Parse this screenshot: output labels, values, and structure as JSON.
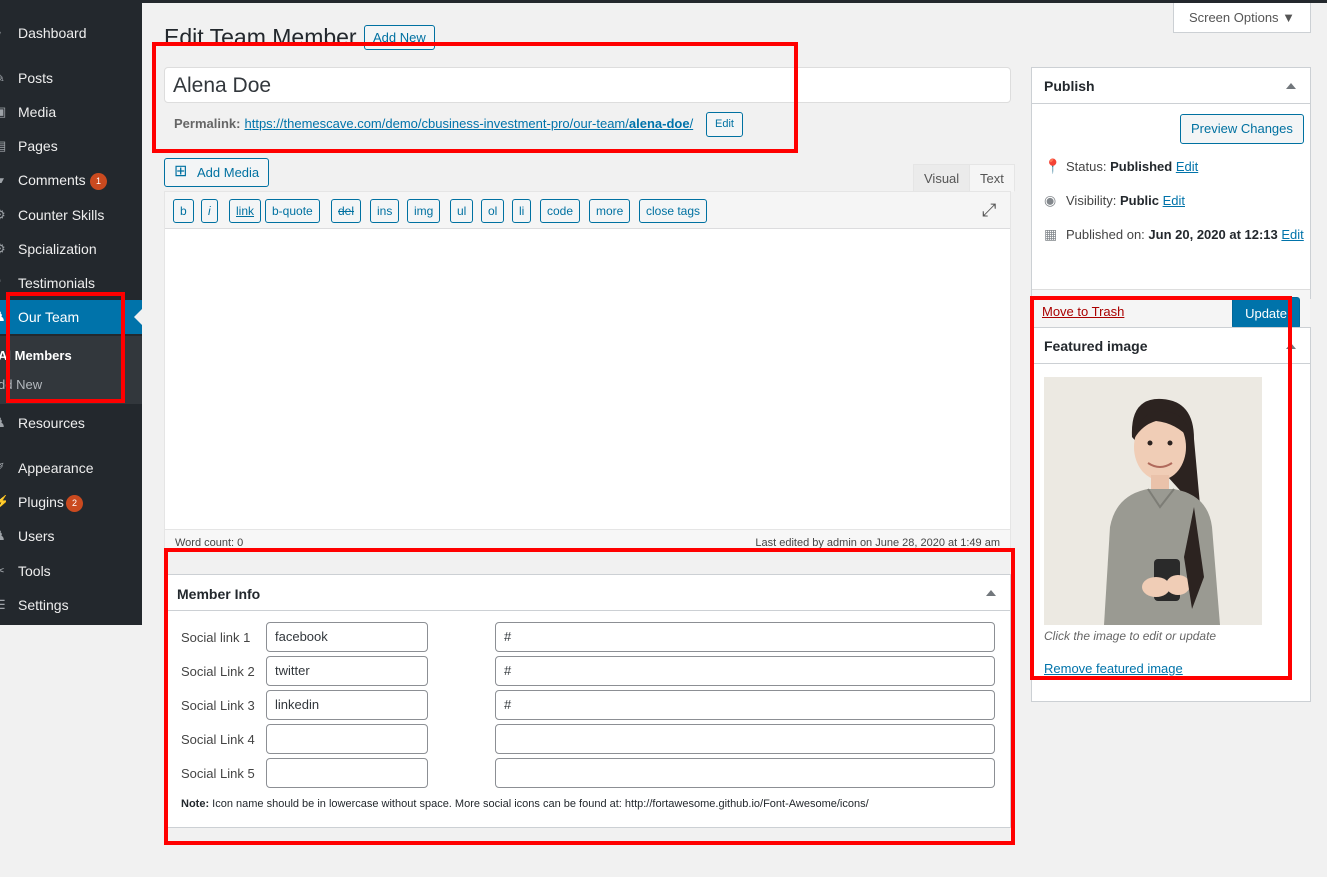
{
  "sidebar": {
    "items": [
      {
        "label": "Dashboard",
        "icon": "dashboard-icon",
        "glyph": "◔"
      },
      {
        "label": "Posts",
        "icon": "pin-icon",
        "glyph": "✎"
      },
      {
        "label": "Media",
        "icon": "media-icon",
        "glyph": "▣"
      },
      {
        "label": "Pages",
        "icon": "page-icon",
        "glyph": "▤"
      },
      {
        "label": "Comments",
        "icon": "comment-icon",
        "glyph": "▰",
        "badge": "1"
      },
      {
        "label": "Counter Skills",
        "icon": "gear-icon",
        "glyph": "⚙"
      },
      {
        "label": "Spcialization",
        "icon": "gear-icon",
        "glyph": "⚙"
      },
      {
        "label": "Testimonials",
        "icon": "quote-icon",
        "glyph": "❝"
      },
      {
        "label": "Our Team",
        "icon": "team-icon",
        "glyph": "♟"
      },
      {
        "label": "Resources",
        "icon": "user-icon",
        "glyph": "♟"
      },
      {
        "label": "Appearance",
        "icon": "brush-icon",
        "glyph": "✐"
      },
      {
        "label": "Plugins",
        "icon": "plugin-icon",
        "glyph": "⚡",
        "badge": "2"
      },
      {
        "label": "Users",
        "icon": "users-icon",
        "glyph": "♟"
      },
      {
        "label": "Tools",
        "icon": "wrench-icon",
        "glyph": "✂"
      },
      {
        "label": "Settings",
        "icon": "settings-icon",
        "glyph": "☰"
      }
    ],
    "submenu": {
      "all_members": "Al Members",
      "add_new": "dd New"
    }
  },
  "header": {
    "title": "Edit Team Member",
    "add_new": "Add New",
    "screen_options": "Screen Options ▼"
  },
  "post": {
    "title": "Alena Doe",
    "permalink_label": "Permalink:",
    "permalink_base": "https://themescave.com/demo/cbusiness-investment-pro/our-team/",
    "permalink_slug": "alena-doe",
    "permalink_tail": "/",
    "edit_slug": "Edit"
  },
  "editor": {
    "add_media": "Add Media",
    "tab_visual": "Visual",
    "tab_text": "Text",
    "quicktags": [
      "b",
      "i",
      "link",
      "b-quote",
      "del",
      "ins",
      "img",
      "ul",
      "ol",
      "li",
      "code",
      "more",
      "close tags"
    ],
    "word_count": "Word count: 0",
    "last_edited": "Last edited by admin on June 28, 2020 at 1:49 am"
  },
  "member_info": {
    "title": "Member Info",
    "rows": [
      {
        "label": "Social link 1",
        "name": "facebook",
        "url": "#"
      },
      {
        "label": "Social Link 2",
        "name": "twitter",
        "url": "#"
      },
      {
        "label": "Social Link 3",
        "name": "linkedin",
        "url": "#"
      },
      {
        "label": "Social Link 4",
        "name": "",
        "url": ""
      },
      {
        "label": "Social Link 5",
        "name": "",
        "url": ""
      }
    ],
    "note_label": "Note:",
    "note_text": " Icon name should be in lowercase without space. More social icons can be found at: http://fortawesome.github.io/Font-Awesome/icons/"
  },
  "publish": {
    "title": "Publish",
    "preview": "Preview Changes",
    "status_label": "Status: ",
    "status_value": "Published",
    "visibility_label": "Visibility: ",
    "visibility_value": "Public",
    "published_label": "Published on: ",
    "published_value": "Jun 20, 2020 at 12:13",
    "edit": "Edit",
    "trash": "Move to Trash",
    "update": "Update"
  },
  "featured_image": {
    "title": "Featured image",
    "caption": "Click the image to edit or update",
    "remove": "Remove featured image"
  },
  "colors": {
    "admin_bar": "#23282d",
    "accent": "#0073aa",
    "highlight": "#ff0000",
    "badge": "#ca4a1f"
  }
}
